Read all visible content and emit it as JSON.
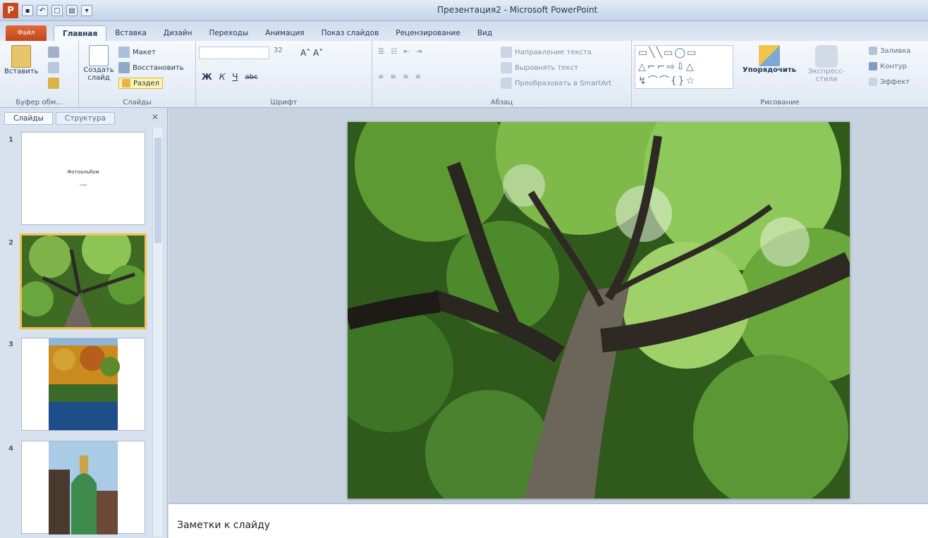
{
  "window": {
    "title": "Презентация2 - Microsoft PowerPoint"
  },
  "ribbon_tabs": [
    {
      "label": "Файл"
    },
    {
      "label": "Главная",
      "active": true
    },
    {
      "label": "Вставка"
    },
    {
      "label": "Дизайн"
    },
    {
      "label": "Переходы"
    },
    {
      "label": "Анимация"
    },
    {
      "label": "Показ слайдов"
    },
    {
      "label": "Рецензирование"
    },
    {
      "label": "Вид"
    }
  ],
  "clipboard": {
    "paste": "Вставить",
    "label": "Буфер обм..."
  },
  "slides_group": {
    "create": "Создать слайд",
    "layout": "Макет",
    "reset": "Восстановить",
    "section": "Раздел",
    "label": "Слайды"
  },
  "font_group": {
    "size": "32",
    "bold": "Ж",
    "italic": "К",
    "underline": "Ч",
    "strike": "abc",
    "label": "Шрифт"
  },
  "paragraph_group": {
    "text_direction": "Направление текста",
    "align_text": "Выровнять текст",
    "smartart": "Преобразовать в SmartArt",
    "label": "Абзац"
  },
  "drawing_group": {
    "arrange": "Упорядочить",
    "quick_styles": "Экспресс-стили",
    "fill": "Заливка",
    "outline": "Контур",
    "effects": "Эффект",
    "label": "Рисование"
  },
  "panel": {
    "tabs": [
      {
        "label": "Слайды",
        "active": true
      },
      {
        "label": "Структура"
      }
    ],
    "close": "✕",
    "slides": [
      {
        "number": "1",
        "title": "Фотоальбом",
        "subtitle": "мой"
      },
      {
        "number": "2",
        "selected": true
      },
      {
        "number": "3"
      },
      {
        "number": "4"
      }
    ]
  },
  "notes": {
    "placeholder": "Заметки к слайду"
  },
  "colors": {
    "accent": "#c2461a",
    "selection": "#f2c14e",
    "ribbon": "#dfe8f3"
  }
}
